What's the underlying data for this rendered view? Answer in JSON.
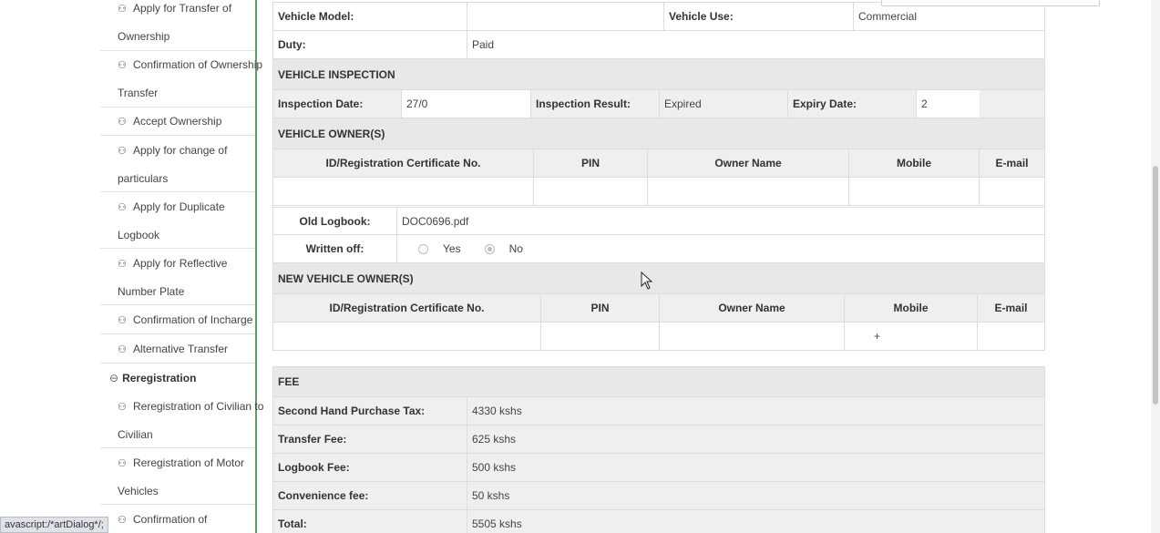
{
  "sidebar": {
    "items": [
      {
        "line1": "Apply for Transfer of",
        "line2": "Ownership"
      },
      {
        "line1": "Confirmation of Ownership",
        "line2": "Transfer"
      },
      {
        "line1": "Accept Ownership"
      },
      {
        "line1": "Apply for change of",
        "line2": "particulars"
      },
      {
        "line1": "Apply for Duplicate",
        "line2": "Logbook"
      },
      {
        "line1": "Apply for Reflective",
        "line2": "Number Plate"
      },
      {
        "line1": "Confirmation of Incharge"
      },
      {
        "line1": "Alternative Transfer"
      }
    ],
    "section_reregistration": "Reregistration",
    "items2": [
      {
        "line1": "Reregistration of Civilian to",
        "line2": "Civilian"
      },
      {
        "line1": "Reregistration of Motor",
        "line2": "Vehicles"
      },
      {
        "line1": "Confirmation of"
      }
    ]
  },
  "vehicle": {
    "model_label": "Vehicle Model:",
    "model_value": "",
    "use_label": "Vehicle Use:",
    "use_value": "Commercial",
    "duty_label": "Duty:",
    "duty_value": "Paid"
  },
  "inspection": {
    "title": "VEHICLE INSPECTION",
    "date_label": "Inspection Date:",
    "date_value": "27/0",
    "result_label": "Inspection Result:",
    "result_value": "Expired",
    "expiry_label": "Expiry Date:",
    "expiry_value": "2"
  },
  "owners": {
    "title": "VEHICLE OWNER(S)",
    "columns": [
      "ID/Registration Certificate No.",
      "PIN",
      "Owner Name",
      "Mobile",
      "E-mail"
    ]
  },
  "logbook": {
    "old_label": "Old Logbook:",
    "old_value": "DOC0696.pdf",
    "written_off_label": "Written off:",
    "yes": "Yes",
    "no": "No"
  },
  "new_owners": {
    "title": "NEW VEHICLE OWNER(S)",
    "columns": [
      "ID/Registration Certificate No.",
      "PIN",
      "Owner Name",
      "Mobile",
      "E-mail"
    ],
    "mobile_value": "+"
  },
  "fee": {
    "title": "FEE",
    "rows": [
      {
        "label": "Second Hand Purchase Tax:",
        "value": "4330 kshs"
      },
      {
        "label": "Transfer Fee:",
        "value": "625 kshs"
      },
      {
        "label": "Logbook Fee:",
        "value": "500 kshs"
      },
      {
        "label": "Convenience fee:",
        "value": "50 kshs"
      },
      {
        "label": "Total:",
        "value": "5505 kshs"
      }
    ]
  },
  "status_bar": "avascript:/*artDialog*/;",
  "colors": {
    "sidebar_border": "#5aa06a",
    "section_bg": "#e8e8e8",
    "row_shaded": "#efefef"
  }
}
